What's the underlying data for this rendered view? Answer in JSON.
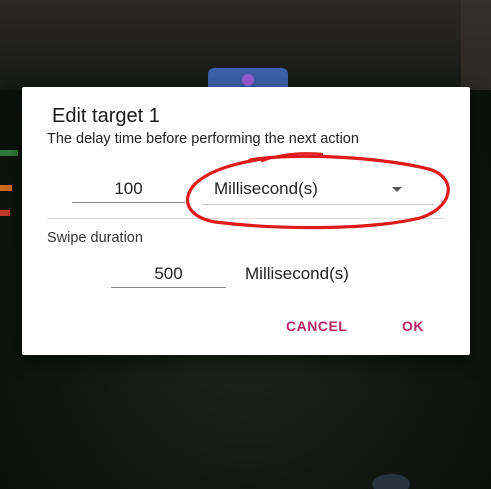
{
  "dialog": {
    "title": "Edit target 1",
    "description": "The delay time before performing the next action",
    "delay_value": "100",
    "delay_unit": "Millisecond(s)",
    "swipe_label": "Swipe duration",
    "swipe_value": "500",
    "swipe_unit": "Millisecond(s)",
    "cancel_label": "CANCEL",
    "ok_label": "OK"
  },
  "colors": {
    "accent": "#b72566",
    "annotation": "#e0191a",
    "dialog_bg": "#ffffff",
    "backdrop": "#101611"
  },
  "icons": {
    "unit_dropdown": "chevron-down-icon"
  }
}
